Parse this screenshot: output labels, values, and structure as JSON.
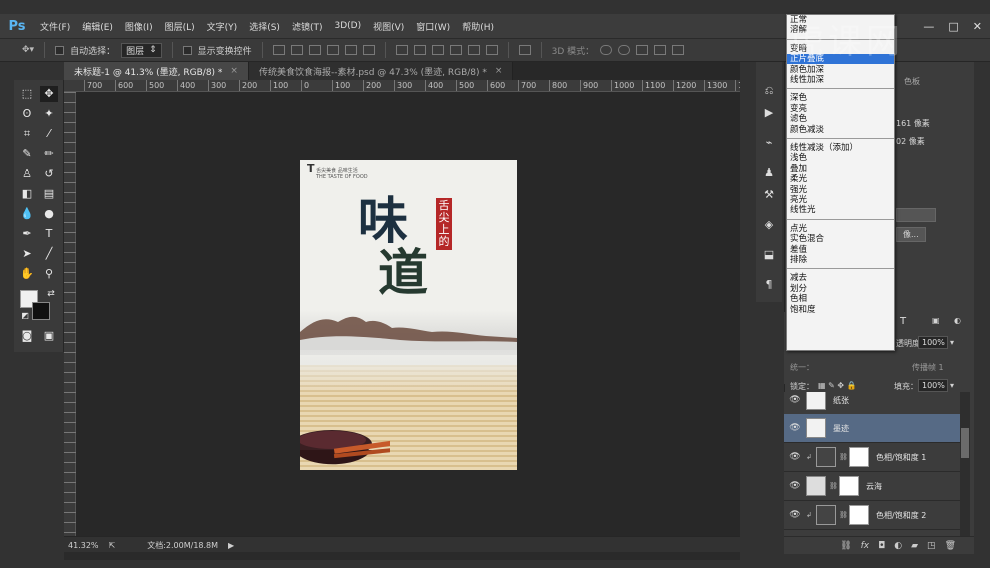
{
  "app": {
    "logo": "Ps"
  },
  "menu": [
    "文件(F)",
    "编辑(E)",
    "图像(I)",
    "图层(L)",
    "文字(Y)",
    "选择(S)",
    "滤镜(T)",
    "3D(D)",
    "视图(V)",
    "窗口(W)",
    "帮助(H)"
  ],
  "window_controls": {
    "minimize": "—",
    "restore": "□",
    "close": "✕"
  },
  "watermark": "虎课网",
  "options_bar": {
    "auto_select_label": "自动选择：",
    "auto_select_value": "图层",
    "show_transform_label": "显示变换控件",
    "mode_3d_label": "3D 模式："
  },
  "tabs": [
    {
      "title": "未标题-1 @ 41.3% (墨迹, RGB/8) *",
      "close": "×",
      "active": true
    },
    {
      "title": "传统美食饮食海报--素材.psd @ 47.3% (墨迹, RGB/8) *",
      "close": "×",
      "active": false
    }
  ],
  "ruler_h": [
    "700",
    "600",
    "500",
    "400",
    "300",
    "200",
    "100",
    "0",
    "100",
    "200",
    "300",
    "400",
    "500",
    "600",
    "700",
    "800",
    "900",
    "1000",
    "1100",
    "1200",
    "1300",
    "1400"
  ],
  "poster": {
    "title_char1": "味",
    "title_char2": "道",
    "seal_text": "舌尖上的",
    "small_heading": "T",
    "small_line1": "舌尖美食 品味生活",
    "small_line2": "THE TASTE OF FOOD"
  },
  "status": {
    "zoom": "41.32%",
    "doc": "文档:2.00M/18.8M"
  },
  "properties": {
    "width_value": "161 像素",
    "height_value": "02 像素",
    "color_tab": "色板",
    "button_text": "像..."
  },
  "layers_panel": {
    "opacity_label": "透明度：",
    "opacity_value": "100%",
    "unify_label": "统一：",
    "propagate_label": "传播帧 1",
    "lock_label": "锁定：",
    "fill_label": "填充：",
    "fill_value": "100%"
  },
  "layers": [
    {
      "name": "纸张",
      "type": "image",
      "selected": false
    },
    {
      "name": "墨迹",
      "type": "image",
      "selected": true
    },
    {
      "name": "色相/饱和度 1",
      "type": "adjustment",
      "selected": false
    },
    {
      "name": "云海",
      "type": "group",
      "selected": false
    },
    {
      "name": "色相/饱和度 2",
      "type": "adjustment",
      "selected": false
    }
  ],
  "blend_modes": [
    {
      "label": "正常",
      "highlight": false
    },
    {
      "label": "溶解",
      "highlight": false
    },
    {
      "label": "变暗",
      "highlight": false
    },
    {
      "label": "正片叠底",
      "highlight": true
    },
    {
      "label": "颜色加深",
      "highlight": false
    },
    {
      "label": "线性加深",
      "highlight": false
    },
    {
      "label": "深色",
      "highlight": false
    },
    {
      "label": "变亮",
      "highlight": false
    },
    {
      "label": "滤色",
      "highlight": false
    },
    {
      "label": "颜色减淡",
      "highlight": false
    },
    {
      "label": "线性减淡（添加）",
      "highlight": false
    },
    {
      "label": "浅色",
      "highlight": false
    },
    {
      "label": "叠加",
      "highlight": false
    },
    {
      "label": "柔光",
      "highlight": false
    },
    {
      "label": "强光",
      "highlight": false
    },
    {
      "label": "亮光",
      "highlight": false
    },
    {
      "label": "线性光",
      "highlight": false
    },
    {
      "label": "点光",
      "highlight": false
    },
    {
      "label": "实色混合",
      "highlight": false
    },
    {
      "label": "差值",
      "highlight": false
    },
    {
      "label": "排除",
      "highlight": false
    },
    {
      "label": "减去",
      "highlight": false
    },
    {
      "label": "划分",
      "highlight": false
    },
    {
      "label": "色相",
      "highlight": false
    },
    {
      "label": "饱和度",
      "highlight": false
    },
    {
      "label": "颜色",
      "highlight": false
    },
    {
      "label": "明度",
      "highlight": false
    }
  ],
  "colors": {
    "accent": "#2f73d6",
    "selected_layer": "#566a85",
    "seal": "#b52727",
    "ps_blue": "#5ab6f4"
  }
}
